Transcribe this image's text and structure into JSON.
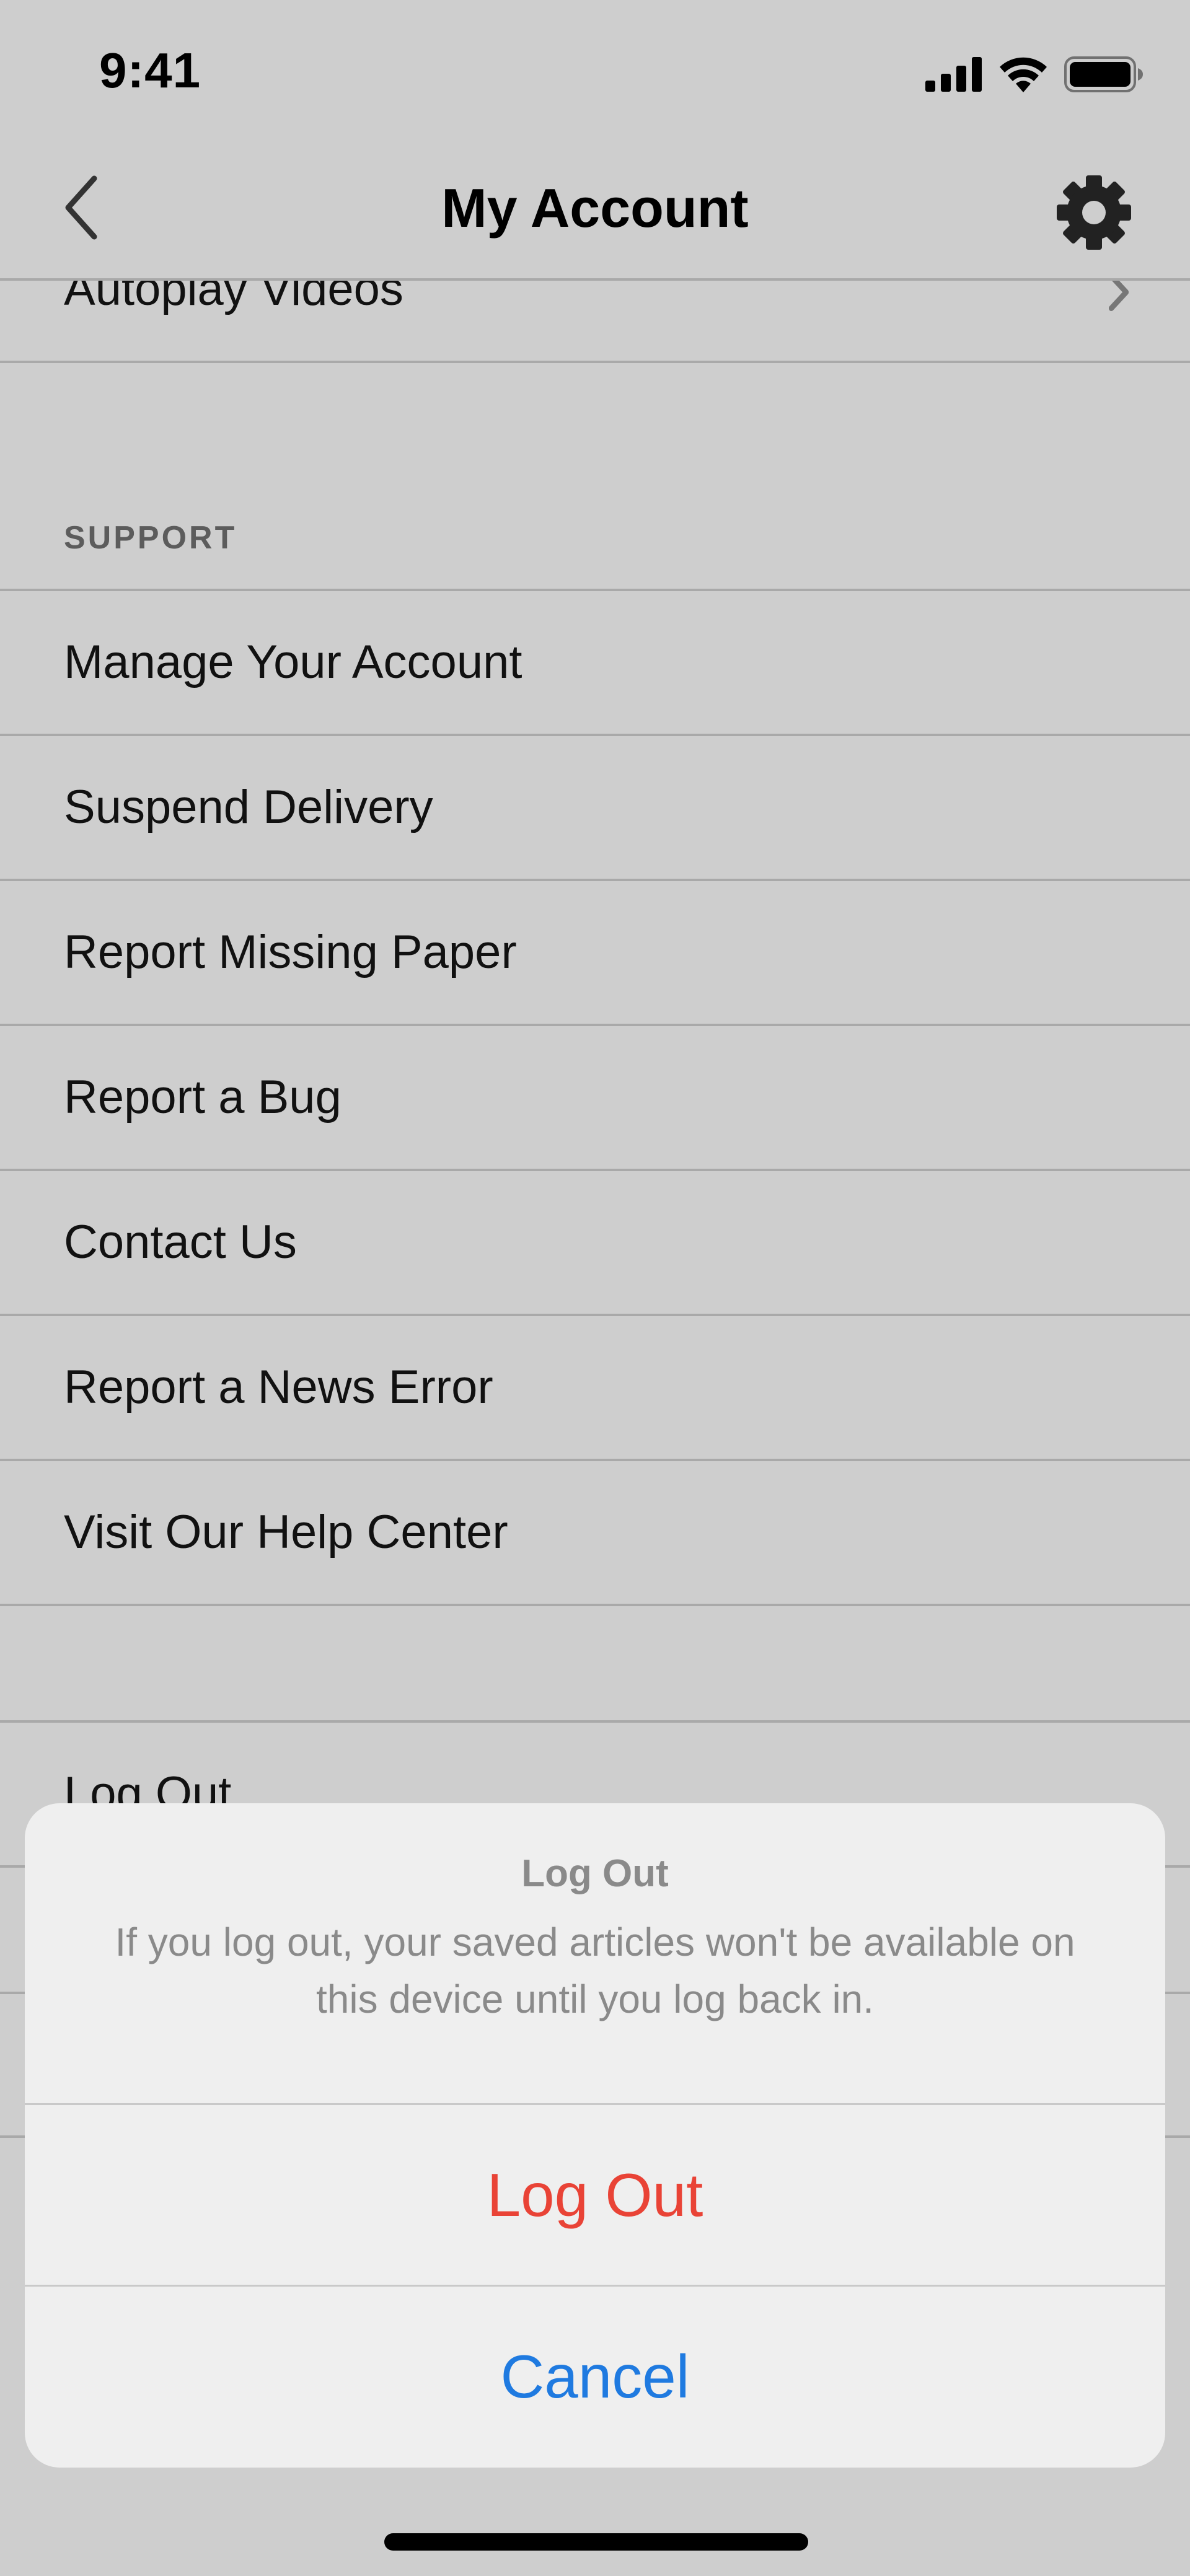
{
  "status_bar": {
    "time": "9:41",
    "icons": [
      "cellular-signal-icon",
      "wifi-icon",
      "battery-icon"
    ]
  },
  "nav": {
    "back_icon": "chevron-left-icon",
    "title": "My Account",
    "settings_icon": "gear-icon"
  },
  "settings_list": {
    "partial_row_label": "Autoplay Videos",
    "partial_row_icon": "chevron-right-icon"
  },
  "support": {
    "header": "SUPPORT",
    "items": [
      {
        "label": "Manage Your Account"
      },
      {
        "label": "Suspend Delivery"
      },
      {
        "label": "Report Missing Paper"
      },
      {
        "label": "Report a Bug"
      },
      {
        "label": "Contact Us"
      },
      {
        "label": "Report a News Error"
      },
      {
        "label": "Visit Our Help Center"
      }
    ]
  },
  "account": {
    "logout_row_label": "Log Out"
  },
  "action_sheet": {
    "title": "Log Out",
    "message": "If you log out, your saved articles won't be available on this device until you log back in.",
    "confirm_label": "Log Out",
    "cancel_label": "Cancel"
  },
  "colors": {
    "background": "#cecece",
    "destructive": "#e94336",
    "cancel": "#1f7ae0",
    "sheet": "#efefef"
  }
}
